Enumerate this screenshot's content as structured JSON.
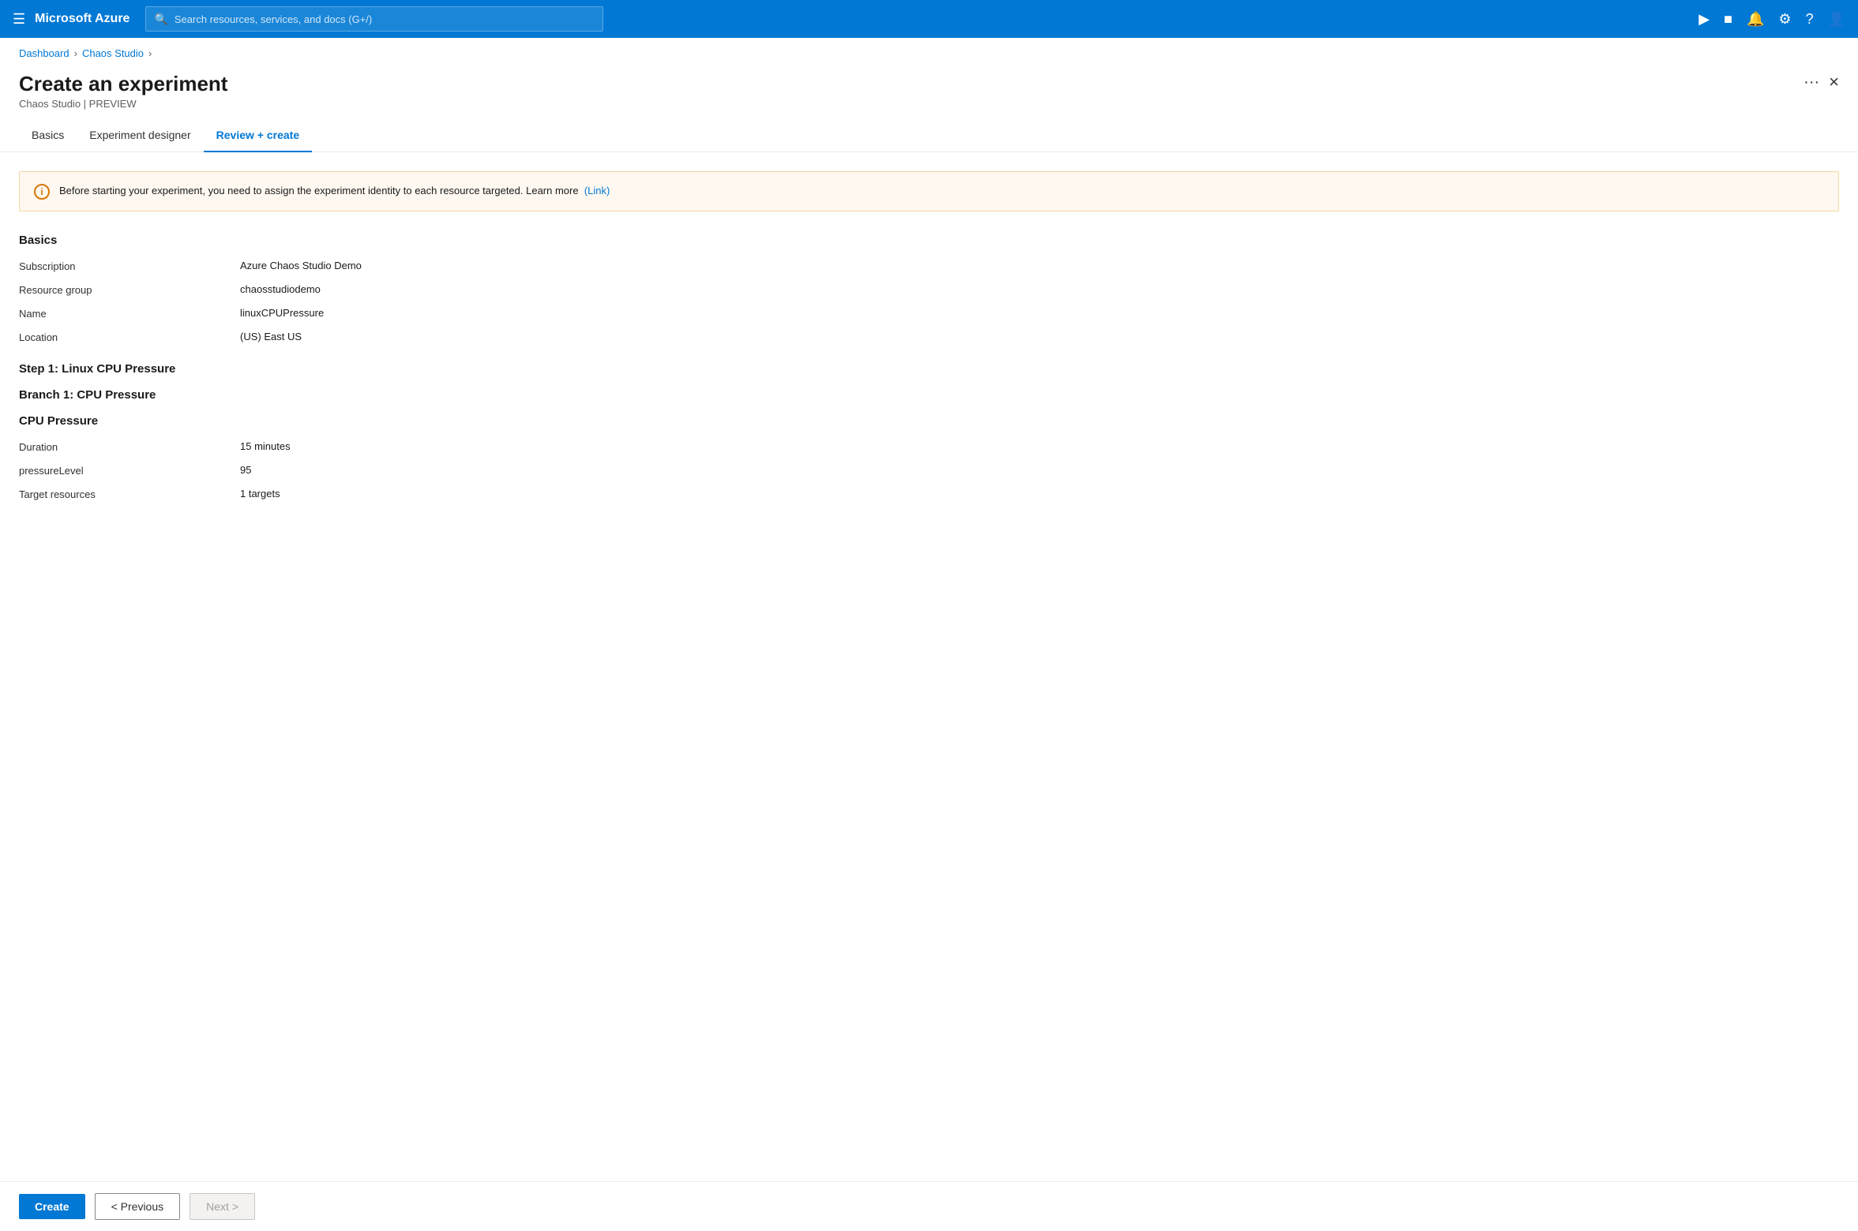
{
  "topnav": {
    "brand": "Microsoft Azure",
    "search_placeholder": "Search resources, services, and docs (G+/)"
  },
  "breadcrumb": {
    "items": [
      "Dashboard",
      "Chaos Studio"
    ]
  },
  "page": {
    "title": "Create an experiment",
    "subtitle": "Chaos Studio | PREVIEW",
    "more_label": "···",
    "close_label": "×"
  },
  "tabs": [
    {
      "id": "basics",
      "label": "Basics",
      "active": false
    },
    {
      "id": "experiment-designer",
      "label": "Experiment designer",
      "active": false
    },
    {
      "id": "review-create",
      "label": "Review + create",
      "active": true
    }
  ],
  "banner": {
    "text": "Before starting your experiment, you need to assign the experiment identity to each resource targeted. Learn more",
    "link_text": "(Link)"
  },
  "basics_section": {
    "title": "Basics",
    "fields": [
      {
        "label": "Subscription",
        "value": "Azure Chaos Studio Demo"
      },
      {
        "label": "Resource group",
        "value": "chaosstudiodemo"
      },
      {
        "label": "Name",
        "value": "linuxCPUPressure"
      },
      {
        "label": "Location",
        "value": "(US) East US"
      }
    ]
  },
  "step1": {
    "title": "Step 1: Linux CPU Pressure"
  },
  "branch1": {
    "title": "Branch 1: CPU Pressure"
  },
  "fault": {
    "title": "CPU Pressure",
    "fields": [
      {
        "label": "Duration",
        "value": "15 minutes"
      },
      {
        "label": "pressureLevel",
        "value": "95"
      },
      {
        "label": "Target resources",
        "value": "1 targets"
      }
    ]
  },
  "footer": {
    "create_label": "Create",
    "previous_label": "< Previous",
    "next_label": "Next >"
  }
}
